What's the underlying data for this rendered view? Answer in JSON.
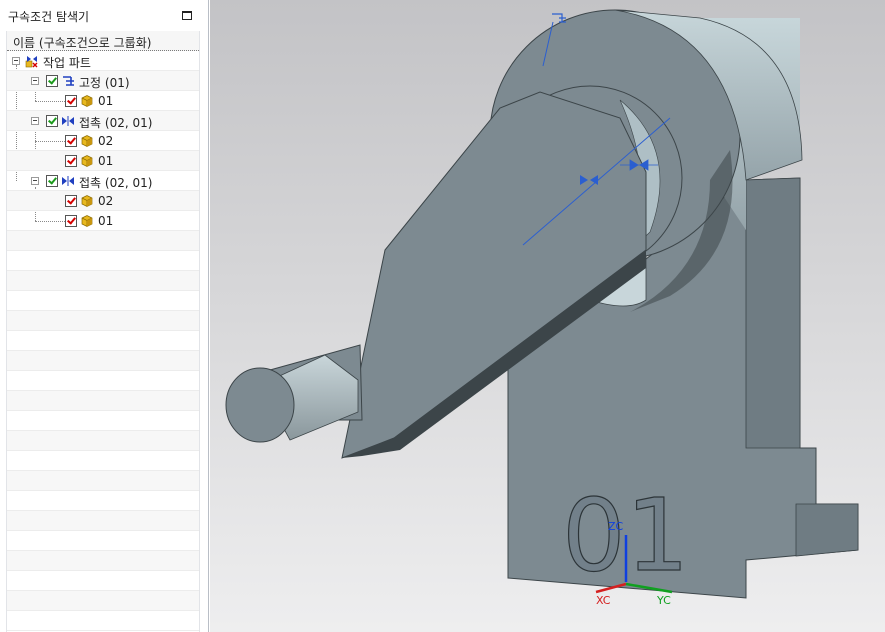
{
  "panel": {
    "title": "구속조건 탐색기",
    "column_header": "이름 (구속조건으로 그룹화)"
  },
  "tree": {
    "root": {
      "label": "작업 파트"
    },
    "groups": [
      {
        "label": "고정 (01)",
        "type": "fixed",
        "children": [
          {
            "label": "01"
          }
        ]
      },
      {
        "label": "접촉 (02, 01)",
        "type": "touch",
        "children": [
          {
            "label": "02"
          },
          {
            "label": "01"
          }
        ]
      },
      {
        "label": "접촉 (02, 01)",
        "type": "touch",
        "children": [
          {
            "label": "02"
          },
          {
            "label": "01"
          }
        ]
      }
    ]
  },
  "viewport": {
    "part_label": "01",
    "triad": {
      "x": "XC",
      "y": "YC",
      "z": "ZC"
    },
    "colors": {
      "part_face": "#7d8a91",
      "part_light": "#b9cbd1",
      "part_dark": "#3c4549",
      "constraint_blue": "#2b5fd0",
      "axis_x": "#d42020",
      "axis_y": "#10a020",
      "axis_z": "#1040e0"
    }
  }
}
